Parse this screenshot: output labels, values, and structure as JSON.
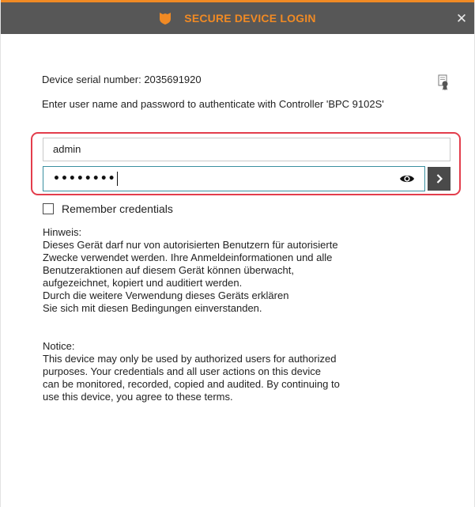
{
  "window": {
    "title": "SECURE DEVICE LOGIN",
    "close_glyph": "✕"
  },
  "device": {
    "serial_text": "Device serial number: 2035691920"
  },
  "prompt": {
    "text": "Enter user name and password to authenticate with Controller 'BPC 9102S'"
  },
  "login": {
    "username_value": "admin",
    "password_masked": "••••••••",
    "submit_glyph": "›"
  },
  "remember": {
    "label": "Remember credentials",
    "checked": false
  },
  "notice_de": {
    "heading": "Hinweis:",
    "lines": [
      "Dieses Gerät darf nur von autorisierten Benutzern für autorisierte",
      "Zwecke verwendet werden. Ihre Anmeldeinformationen und alle",
      "Benutzeraktionen auf diesem Gerät können überwacht,",
      "aufgezeichnet, kopiert und auditiert werden.",
      "Durch die weitere Verwendung dieses Geräts erklären",
      "Sie sich mit diesen Bedingungen einverstanden."
    ]
  },
  "notice_en": {
    "heading": "Notice:",
    "lines": [
      "This device may only be used by authorized users for authorized",
      "purposes. Your credentials and all user actions on this device",
      "can be monitored, recorded, copied and audited. By continuing to",
      "use this device, you agree to these terms."
    ]
  },
  "colors": {
    "accent": "#f08a24",
    "titlebar": "#575757",
    "highlight": "#e33d4c",
    "focus_border": "#3a8fa0",
    "submit_bg": "#4a4a4a"
  },
  "icons": {
    "logo": "shield-logo-icon",
    "certificate": "certificate-icon",
    "visibility": "eye-icon",
    "submit": "chevron-right-icon",
    "close": "close-icon"
  }
}
